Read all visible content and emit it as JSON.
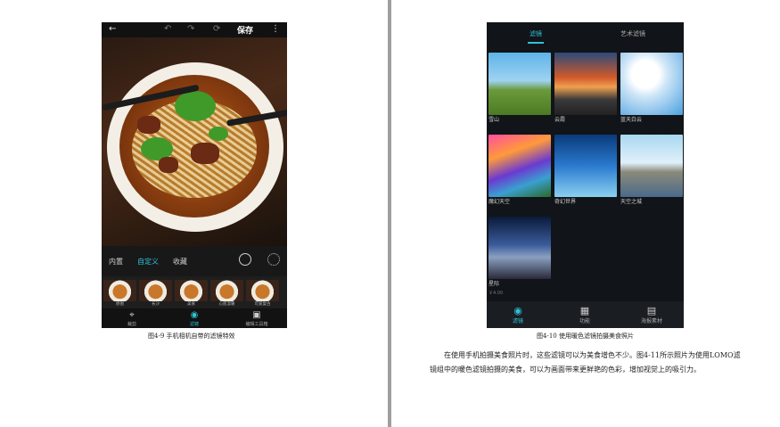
{
  "left_phone": {
    "topbar": {
      "back_icon": "arrow-left-icon",
      "undo_icon": "undo-icon",
      "redo_icon": "redo-icon",
      "rotate_icon": "rotate-icon",
      "save_label": "保存",
      "more_icon": "more-vertical-icon"
    },
    "tabs": [
      {
        "label": "内置",
        "active": false
      },
      {
        "label": "自定义",
        "active": true
      },
      {
        "label": "收藏",
        "active": false
      }
    ],
    "filters": [
      "原图",
      "长沙",
      "美食",
      "心底温暖",
      "可爱复古"
    ],
    "bottom_nav": [
      {
        "label": "裁剪",
        "icon": "crop-icon",
        "active": false
      },
      {
        "label": "滤镜",
        "icon": "filter-icon",
        "active": true
      },
      {
        "label": "编辑工具箱",
        "icon": "toolbox-icon",
        "active": false
      }
    ]
  },
  "left_caption": "图4-9 手机相机自带的滤镜特效",
  "right_phone": {
    "tabs": [
      {
        "label": "滤镜",
        "active": true
      },
      {
        "label": "艺术滤镜",
        "active": false
      }
    ],
    "filters": [
      {
        "label": "雪山",
        "sub": ""
      },
      {
        "label": "云霞",
        "sub": ""
      },
      {
        "label": "蓝天白云",
        "sub": ""
      },
      {
        "label": "魔幻天空",
        "sub": ""
      },
      {
        "label": "奇幻世界",
        "sub": ""
      },
      {
        "label": "天空之城",
        "sub": ""
      },
      {
        "label": "星际",
        "sub": "￥4.00"
      }
    ],
    "bottom_nav": [
      {
        "label": "滤镜",
        "icon": "filter-icon",
        "active": true
      },
      {
        "label": "功能",
        "icon": "grid-icon",
        "active": false
      },
      {
        "label": "海报素材",
        "icon": "image-icon",
        "active": false
      }
    ]
  },
  "right_caption": "图4-10 使用暖色滤镜拍摄美食照片",
  "paragraph": "在使用手机拍摄美食照片时，这些滤镜可以为美食增色不少。图4-11所示照片为使用LOMO滤镜组中的暖色滤镜拍摄的美食，可以为画面带来更鲜艳的色彩，增加视觉上的吸引力。",
  "colors": {
    "accent": "#2ec3d8",
    "divider": "#9e9e9e"
  }
}
